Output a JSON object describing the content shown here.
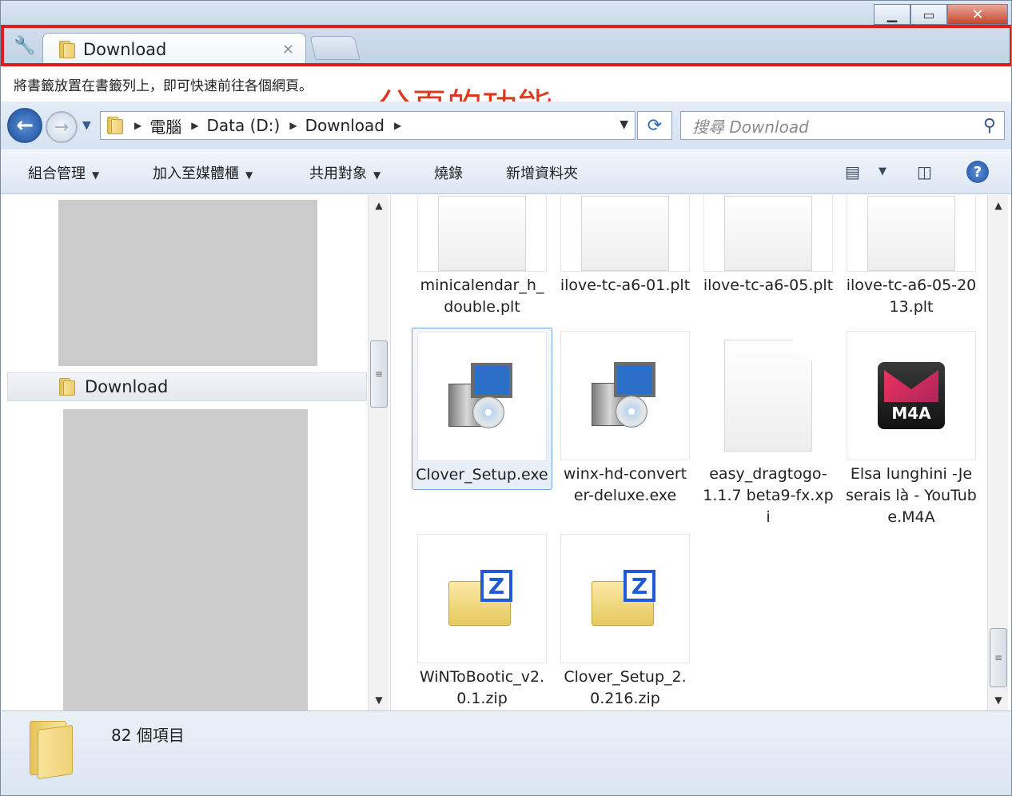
{
  "tab": {
    "title": "Download",
    "close": "×"
  },
  "bookmark_bar": {
    "text": "將書籤放置在書籤列上，即可快速前往各個網頁。"
  },
  "annotation": "分頁的功能",
  "address": {
    "crumbs": [
      "電腦",
      "Data (D:)",
      "Download"
    ],
    "search_placeholder": "搜尋 Download"
  },
  "commands": {
    "organize": "組合管理",
    "add_to_library": "加入至媒體櫃",
    "share_with": "共用對象",
    "burn": "燒錄",
    "new_folder": "新增資料夾"
  },
  "nav": {
    "selected": "Download"
  },
  "files": [
    {
      "name": "minicalendar_h_double.plt",
      "icon": "blank-file-icon"
    },
    {
      "name": "ilove-tc-a6-01.plt",
      "icon": "blank-file-icon"
    },
    {
      "name": "ilove-tc-a6-05.plt",
      "icon": "blank-file-icon"
    },
    {
      "name": "ilove-tc-a6-05-2013.plt",
      "icon": "blank-file-icon"
    },
    {
      "name": "Clover_Setup.exe",
      "icon": "installer-icon",
      "selected": true
    },
    {
      "name": "winx-hd-converter-deluxe.exe",
      "icon": "installer-icon"
    },
    {
      "name": "easy_dragtogo-1.1.7 beta9-fx.xpi",
      "icon": "document-icon"
    },
    {
      "name": "Elsa lunghini -Je serais là - YouTube.M4A",
      "icon": "m4a-icon"
    },
    {
      "name": "WiNToBootic_v2.0.1.zip",
      "icon": "zip-icon"
    },
    {
      "name": "Clover_Setup_2.0.216.zip",
      "icon": "zip-icon"
    }
  ],
  "status": {
    "count": "82 個項目"
  },
  "m4a_label": "M4A",
  "zip_letter": "Z",
  "colors": {
    "annotation": "#e0361e",
    "highlight_box": "#e01d1d",
    "selection": "#7da2ce"
  }
}
